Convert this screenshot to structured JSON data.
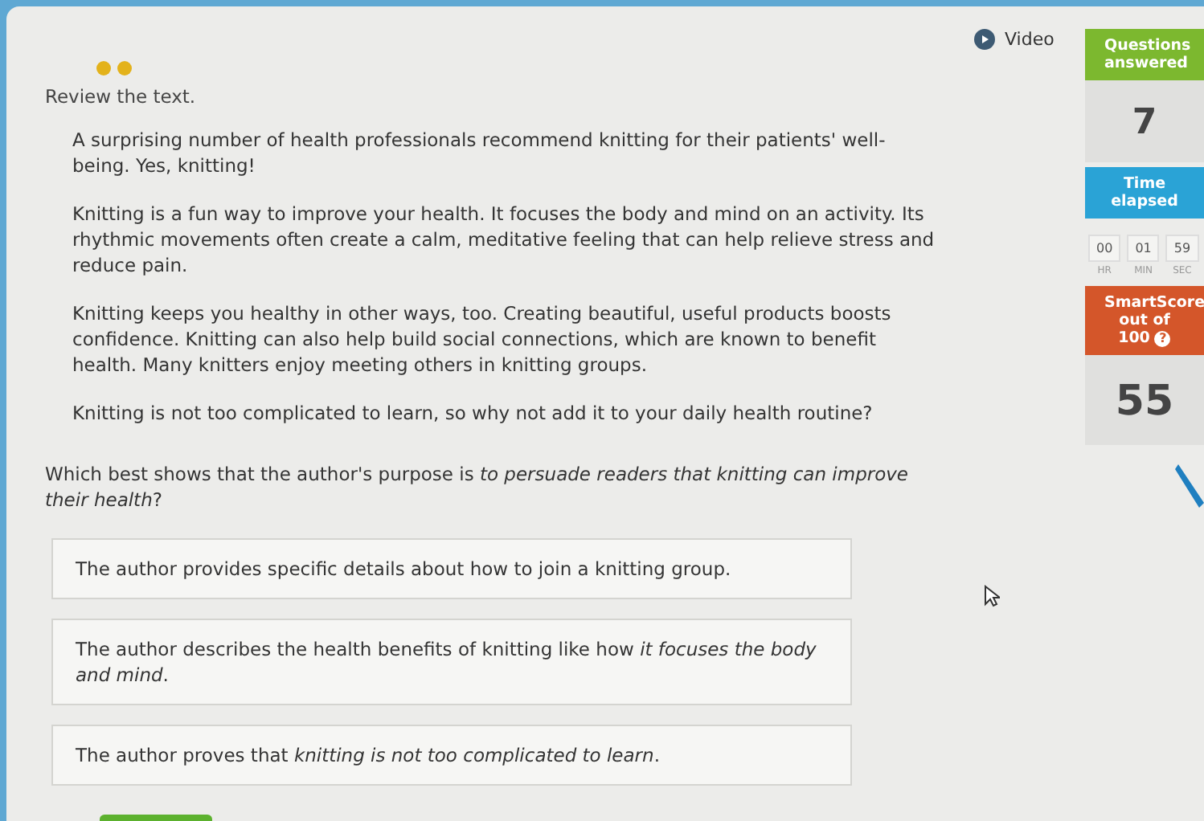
{
  "progress_dots": [
    {
      "color": "#e3b21b"
    },
    {
      "color": "#e3b21b"
    }
  ],
  "instruction": "Review the text.",
  "passage": [
    "A surprising number of health professionals recommend knitting for their patients' well-being. Yes, knitting!",
    "Knitting is a fun way to improve your health. It focuses the body and mind on an activity. Its rhythmic movements often create a calm, meditative feeling that can help relieve stress and reduce pain.",
    "Knitting keeps you healthy in other ways, too. Creating beautiful, useful products boosts confidence. Knitting can also help build social connections, which are known to benefit health. Many knitters enjoy meeting others in knitting groups.",
    "Knitting is not too complicated to learn, so why not add it to your daily health routine?"
  ],
  "question": "Which best shows that the author's purpose is *to persuade readers that knitting can improve their health*?",
  "choices": [
    {
      "text": "The author provides specific details about how to join a knitting group.",
      "selected": false
    },
    {
      "text": "The author describes the health benefits of knitting like how *it focuses the body and mind*.",
      "selected": false
    },
    {
      "text": "The author proves that *knitting is not too complicated to learn*.",
      "selected": false
    }
  ],
  "video": {
    "label": "Video"
  },
  "sidebar": {
    "questions_label": "Questions answered",
    "questions_value": "7",
    "time_label": "Time elapsed",
    "timer": [
      {
        "value": "00",
        "unit": "HR"
      },
      {
        "value": "01",
        "unit": "MIN"
      },
      {
        "value": "59",
        "unit": "SEC"
      }
    ],
    "score_label": "SmartScore",
    "score_sub": "out of 100",
    "score_info": "?",
    "score_value": "55"
  }
}
